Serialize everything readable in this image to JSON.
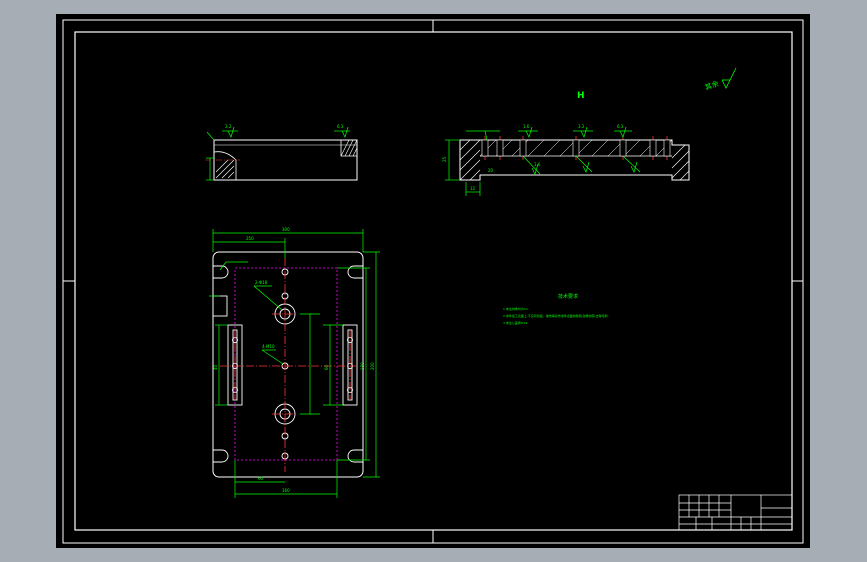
{
  "colors": {
    "background": "#a6adb5",
    "paper": "#000000",
    "frame": "#ffffff",
    "dimension": "#00ff00",
    "center_line": "#ff3030",
    "hidden_line": "#ff00ff",
    "hatch": "#ffffff",
    "title_block": "#ffffff"
  },
  "drawing": {
    "section_label": "H",
    "roughness_symbol_label": "其余",
    "tech_requirements_title": "技术要求",
    "tech_requirements": [
      "1.未注倒角均为C1.",
      "2.零件加工表面上,不应有划痕、擦伤等损伤零件表面的缺陷,锐角倒钝,去除毛刺.",
      "3.未注公差按IT14."
    ],
    "top_view_dims": {
      "overall_width": "300",
      "top_width": "250",
      "height": "200",
      "inner_width": "160",
      "left_width": "60",
      "right_height": "180",
      "side_a": "40",
      "side_b": "60"
    },
    "hole_callouts": {
      "counterbore": "2-Φ18",
      "thread": "4-M10"
    },
    "side_view_dims": {
      "height": "25",
      "depth": "12",
      "thickness": "20"
    },
    "roughness_values": [
      "3.2",
      "6.3",
      "1.6",
      "3.2",
      "6.3",
      "1.6"
    ]
  }
}
